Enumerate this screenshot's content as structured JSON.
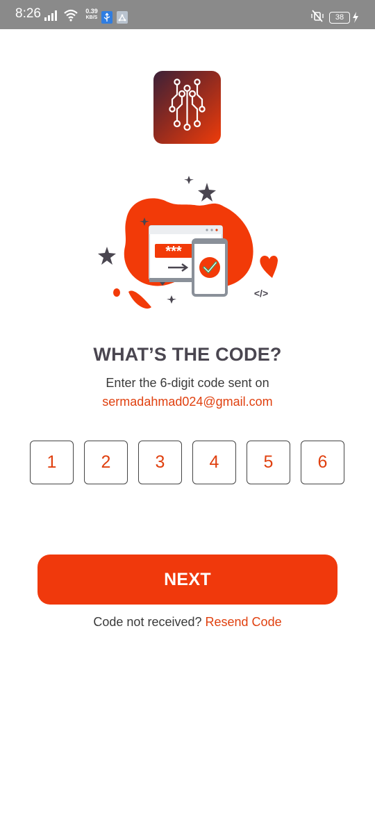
{
  "status_bar": {
    "time": "8:26",
    "speed_value": "0.39",
    "speed_unit": "KB/S",
    "battery": "38",
    "icons": [
      "signal-icon",
      "wifi-icon",
      "usb-icon",
      "folder-icon",
      "mute-icon",
      "battery-icon",
      "charging-icon"
    ]
  },
  "logo": {
    "icon": "circuit-logo-icon"
  },
  "illustration": {
    "icon": "verification-illustration",
    "password_mask": "***",
    "code_tag": "</>"
  },
  "heading": "WHAT’S THE CODE?",
  "subtext": "Enter the 6-digit code sent on",
  "email": "sermadahmad024@gmail.com",
  "otp": [
    "1",
    "2",
    "3",
    "4",
    "5",
    "6"
  ],
  "next_button": "NEXT",
  "resend": {
    "prompt": "Code not received?",
    "link": "Resend Code"
  },
  "colors": {
    "accent": "#f0390c",
    "text_dark": "#4a4650",
    "status_bar": "#8a8a8a"
  }
}
